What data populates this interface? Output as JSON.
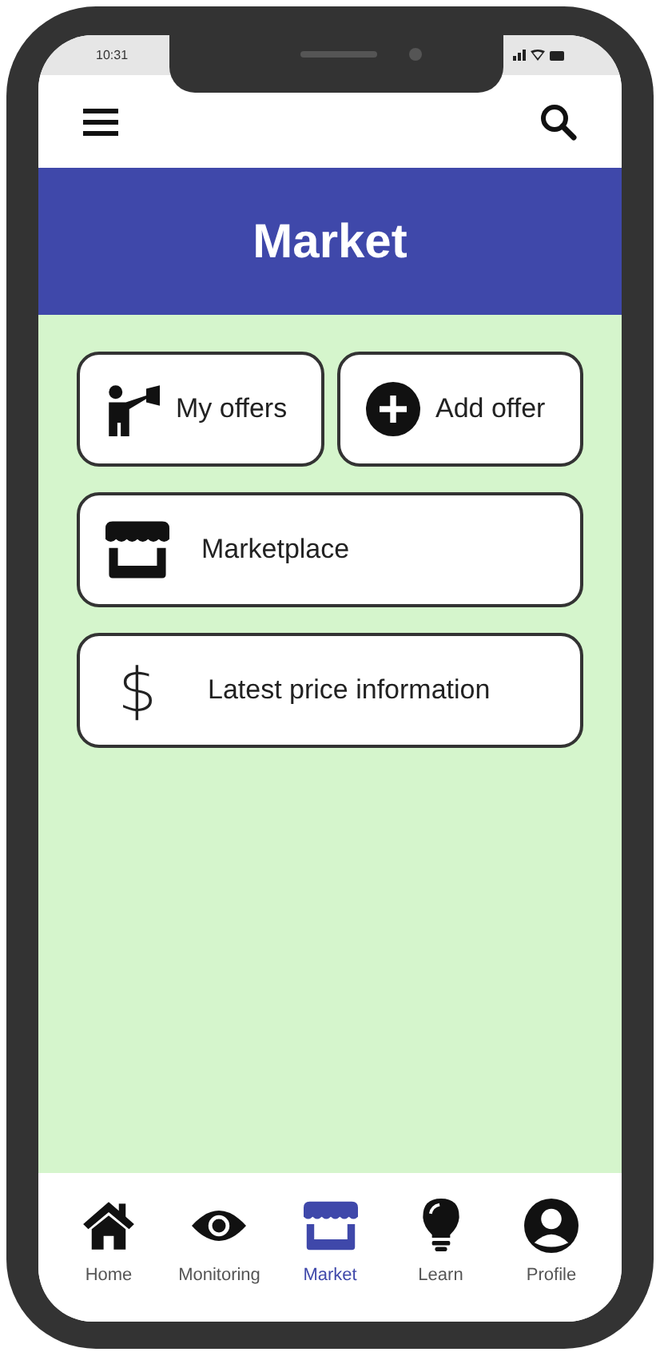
{
  "status_bar": {
    "time": "10:31"
  },
  "header": {
    "title": "Market"
  },
  "action_rows": [
    [
      {
        "label": "My offers",
        "kind": "megaphone"
      },
      {
        "label": "Add offer",
        "kind": "plus"
      }
    ],
    [
      {
        "label": "Marketplace",
        "kind": "store"
      }
    ],
    [
      {
        "label": "Latest price information",
        "kind": "glyph",
        "glyph": "$"
      }
    ]
  ],
  "bottom_nav": [
    {
      "label": "Home",
      "kind": "home",
      "selected": false
    },
    {
      "label": "Monitoring",
      "kind": "eye",
      "selected": false
    },
    {
      "label": "Market",
      "kind": "store",
      "selected": true
    },
    {
      "label": "Learn",
      "kind": "bulb",
      "selected": false
    },
    {
      "label": "Profile",
      "kind": "person",
      "selected": false
    }
  ]
}
